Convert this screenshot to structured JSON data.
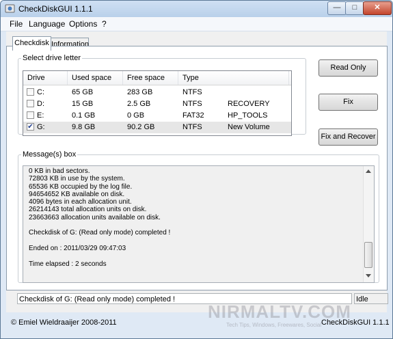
{
  "window": {
    "title": "CheckDiskGUI 1.1.1"
  },
  "menu": [
    "File",
    "Language",
    "Options",
    "?"
  ],
  "tabs": [
    {
      "label": "Checkdisk",
      "active": true
    },
    {
      "label": "Information",
      "active": false
    }
  ],
  "drive_group": {
    "legend": "Select drive letter",
    "columns": [
      "Drive",
      "Used space",
      "Free space",
      "Type"
    ],
    "rows": [
      {
        "checked": false,
        "drive": "C:",
        "used": "65 GB",
        "free": "283 GB",
        "type": "NTFS",
        "label": ""
      },
      {
        "checked": false,
        "drive": "D:",
        "used": "15 GB",
        "free": "2.5 GB",
        "type": "NTFS",
        "label": "RECOVERY"
      },
      {
        "checked": false,
        "drive": "E:",
        "used": "0.1 GB",
        "free": "0 GB",
        "type": "FAT32",
        "label": "HP_TOOLS"
      },
      {
        "checked": true,
        "drive": "G:",
        "used": "9.8 GB",
        "free": "90.2 GB",
        "type": "NTFS",
        "label": "New Volume"
      }
    ]
  },
  "buttons": {
    "read_only": "Read Only",
    "fix": "Fix",
    "fix_recover": "Fix and Recover"
  },
  "messages": {
    "legend": "Message(s) box",
    "lines": [
      "0 KB in bad sectors.",
      "72803 KB in use by the system.",
      "65536 KB occupied by the log file.",
      "94654652 KB available on disk.",
      "4096 bytes in each allocation unit.",
      "26214143 total allocation units on disk.",
      "23663663 allocation units available on disk.",
      "",
      "Checkdisk of G: (Read only mode) completed !",
      "",
      "Ended on : 2011/03/29 09:47:03",
      "",
      "Time elapsed : 2 seconds"
    ]
  },
  "status": {
    "message": "Checkdisk of G: (Read only mode) completed !",
    "state": "Idle"
  },
  "footer": {
    "copyright": "© Emiel Wieldraaijer 2008-2011",
    "version": "CheckDiskGUI 1.1.1"
  },
  "watermark": {
    "site": "NIRMALTV.COM",
    "tagline": "Tech Tips, Windows, Freewares, Social"
  },
  "colors": {
    "title_bar": "#b9d0ea",
    "close_button": "#c4452d",
    "panel": "#f0f0f0"
  }
}
